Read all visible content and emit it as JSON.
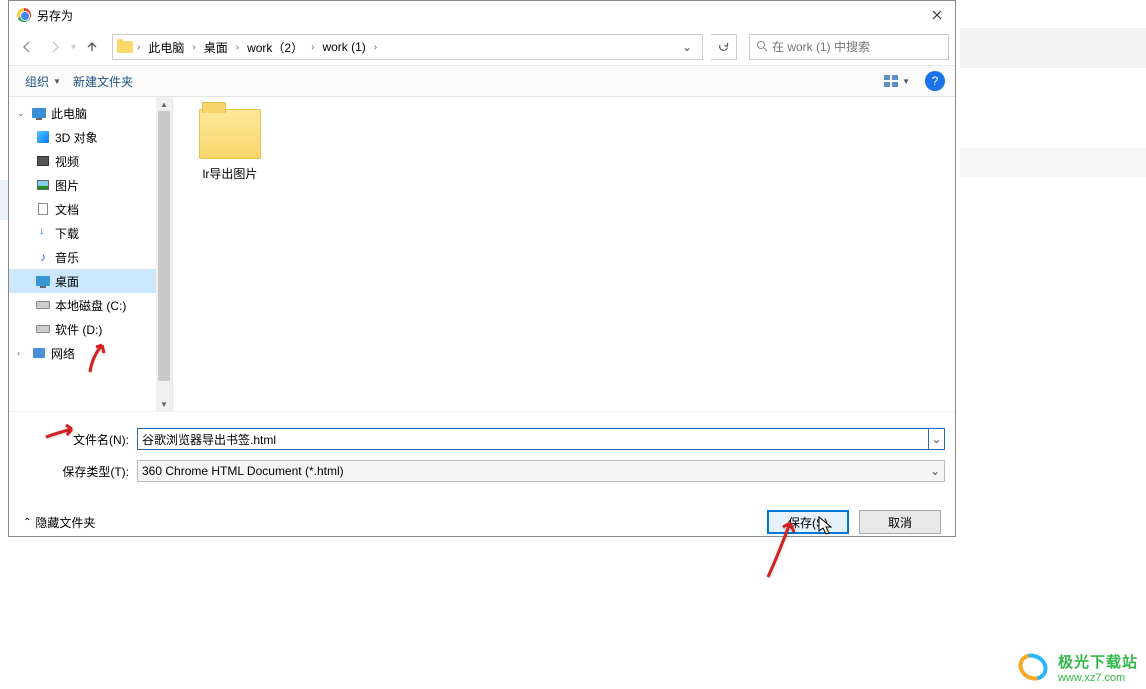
{
  "title": "另存为",
  "breadcrumb": {
    "pc": "此电脑",
    "desktop": "桌面",
    "work2": "work（2）",
    "work1": "work (1)"
  },
  "search": {
    "placeholder": "在 work (1) 中搜索"
  },
  "toolbar": {
    "organize": "组织",
    "newfolder": "新建文件夹"
  },
  "sidebar": {
    "pc": "此电脑",
    "obj3d": "3D 对象",
    "video": "视频",
    "pictures": "图片",
    "docs": "文档",
    "downloads": "下载",
    "music": "音乐",
    "desktop": "桌面",
    "diskc": "本地磁盘 (C:)",
    "diskd": "软件 (D:)",
    "network": "网络"
  },
  "content": {
    "folder1": "lr导出图片"
  },
  "form": {
    "filename_label": "文件名(N):",
    "filename_value": "谷歌浏览器导出书签.html",
    "type_label": "保存类型(T):",
    "type_value": "360 Chrome HTML Document (*.html)"
  },
  "footer": {
    "hide": "隐藏文件夹",
    "save": "保存(S)",
    "cancel": "取消"
  },
  "watermark": {
    "cn": "极光下载站",
    "en": "www.xz7.com"
  }
}
